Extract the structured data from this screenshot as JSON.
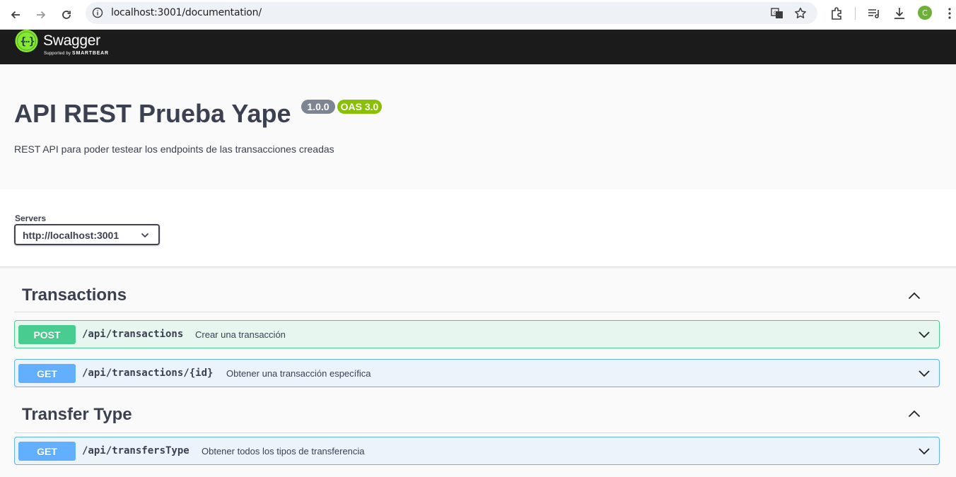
{
  "browser": {
    "url": "localhost:3001/documentation/",
    "avatar_initial": "C"
  },
  "topbar": {
    "brand": "Swagger",
    "sub_prefix": "Supported by ",
    "sub_brand": "SMARTBEAR",
    "brand_color": "#85ea2d"
  },
  "info": {
    "title": "API REST Prueba Yape",
    "version_badge": "1.0.0",
    "oas_badge": "OAS 3.0",
    "description": "REST API para poder testear los endpoints de las transacciones creadas"
  },
  "servers": {
    "label": "Servers",
    "selected": "http://localhost:3001"
  },
  "tags": [
    {
      "name": "Transactions",
      "operations": [
        {
          "method": "POST",
          "path": "/api/transactions",
          "summary": "Crear una transacción"
        },
        {
          "method": "GET",
          "path": "/api/transactions/{id}",
          "summary": "Obtener una transacción específica"
        }
      ]
    },
    {
      "name": "Transfer Type",
      "operations": [
        {
          "method": "GET",
          "path": "/api/transfersType",
          "summary": "Obtener todos los tipos de transferencia"
        }
      ]
    }
  ],
  "colors": {
    "post": "#49cc90",
    "get": "#61affe",
    "badge_version": "#7d8492",
    "badge_oas": "#89bf04",
    "topbar_bg": "#1b1b1b"
  }
}
